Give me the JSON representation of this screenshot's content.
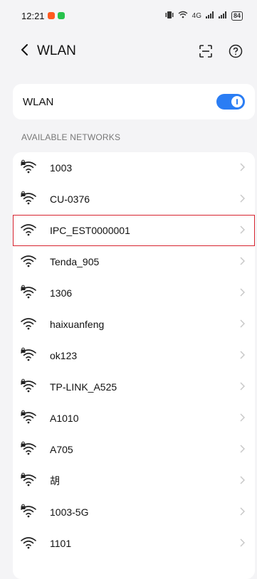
{
  "status": {
    "time": "12:21",
    "signal_text": "4G",
    "battery": "84"
  },
  "header": {
    "back_symbol": "<",
    "title": "WLAN"
  },
  "wlan_toggle": {
    "label": "WLAN",
    "enabled": true
  },
  "section": {
    "available_label": "AVAILABLE NETWORKS"
  },
  "networks": [
    {
      "ssid": "1003",
      "secured": true,
      "highlight": false
    },
    {
      "ssid": "CU-0376",
      "secured": true,
      "highlight": false
    },
    {
      "ssid": "IPC_EST0000001",
      "secured": false,
      "highlight": true
    },
    {
      "ssid": "Tenda_905",
      "secured": false,
      "highlight": false
    },
    {
      "ssid": "1306",
      "secured": true,
      "highlight": false
    },
    {
      "ssid": "haixuanfeng",
      "secured": false,
      "highlight": false
    },
    {
      "ssid": "ok123",
      "secured": true,
      "highlight": false
    },
    {
      "ssid": "TP-LINK_A525",
      "secured": true,
      "highlight": false
    },
    {
      "ssid": "A1010",
      "secured": true,
      "highlight": false
    },
    {
      "ssid": "A705",
      "secured": true,
      "highlight": false
    },
    {
      "ssid": "胡",
      "secured": true,
      "highlight": false
    },
    {
      "ssid": "1003-5G",
      "secured": true,
      "highlight": false
    },
    {
      "ssid": "1101",
      "secured": false,
      "highlight": false
    }
  ],
  "colors": {
    "accent": "#2a7df4",
    "highlight": "#d8242f",
    "notif_orange": "#ff5a1f",
    "notif_green": "#27c24c"
  },
  "icons": {
    "back": "back-chevron-icon",
    "scan": "scan-icon",
    "help": "help-icon",
    "row_chevron": "chevron-right-icon",
    "wifi": "wifi-icon"
  }
}
